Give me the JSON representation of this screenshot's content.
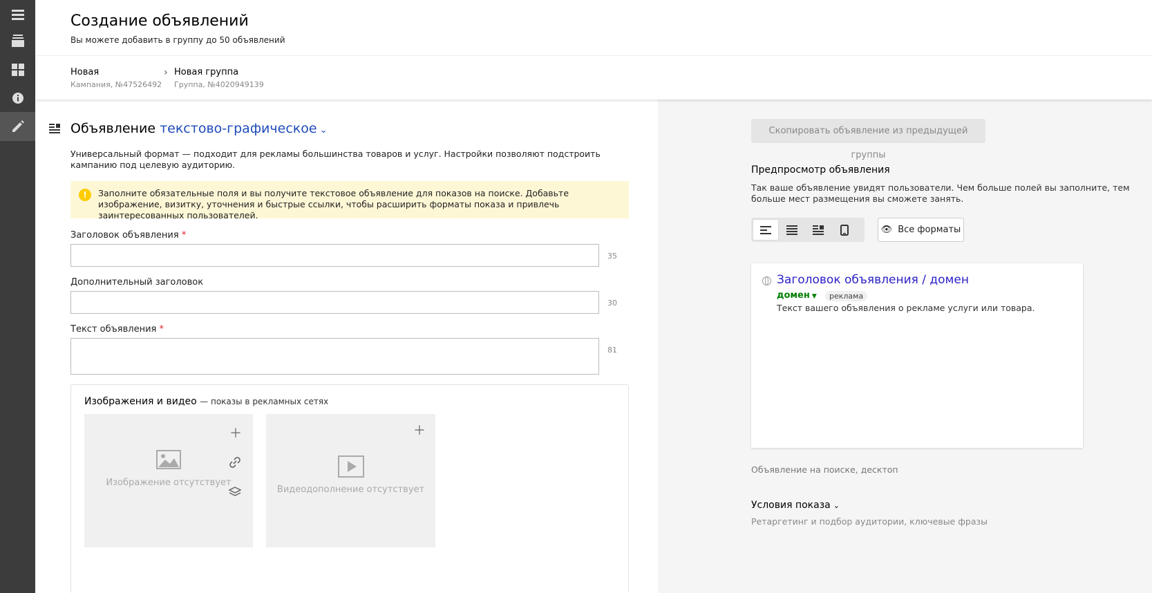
{
  "sidebar": {
    "items": [
      {
        "icon": "menu-icon"
      },
      {
        "icon": "campaigns-stack-icon"
      },
      {
        "icon": "dashboard-grid-icon"
      },
      {
        "icon": "info-icon"
      },
      {
        "icon": "pencil-icon",
        "active": true
      }
    ]
  },
  "header": {
    "title": "Создание объявлений",
    "subtitle": "Вы можете добавить в группу до 50 объявлений"
  },
  "breadcrumbs": [
    {
      "title": "Новая",
      "sub": "Кампания, №47526492"
    },
    {
      "title": "Новая группа",
      "sub": "Группа, №4020949139"
    }
  ],
  "ad": {
    "title_prefix": "Объявление",
    "type": "текстово-графическое",
    "description": "Универсальный формат — подходит для рекламы большинства товаров и услуг. Настройки позволяют подстроить кампанию под целевую аудиторию.",
    "notice": "Заполните обязательные поля и вы получите текстовое объявление для показов на поиске. Добавьте изображение, визитку, уточнения и быстрые ссылки, чтобы расширить форматы показа и привлечь заинтересованных пользователей."
  },
  "fields": {
    "headline": {
      "label": "Заголовок объявления",
      "required_mark": "*",
      "value": "",
      "counter": "35"
    },
    "extra_headline": {
      "label": "Дополнительный заголовок",
      "value": "",
      "counter": "30"
    },
    "text": {
      "label": "Текст объявления",
      "required_mark": "*",
      "value": "",
      "counter": "81"
    }
  },
  "media": {
    "title": "Изображения и видео",
    "subtitle": "— показы в рекламных сетях",
    "image_empty": "Изображение отсутствует",
    "video_empty": "Видеодополнение отсутствует"
  },
  "preview": {
    "copy_button": "Скопировать объявление из предыдущей группы",
    "title": "Предпросмотр объявления",
    "description": "Так ваше объявление увидят пользователи. Чем больше полей вы заполните, тем больше мест размещения вы сможете занять.",
    "all_formats": "Все форматы",
    "card": {
      "title": "Заголовок объявления / домен",
      "domain": "домен",
      "badge": "реклама",
      "text": "Текст вашего объявления о рекламе услуги или товара."
    },
    "caption": "Объявление на поиске, десктоп"
  },
  "conditions": {
    "title": "Условия показа",
    "subtitle": "Ретаргетинг и подбор аудитории, ключевые фразы"
  },
  "colors": {
    "sidebar": "#3c3c3c",
    "link_blue": "#1e4bb8",
    "preview_title": "#2a22c6",
    "domain_green": "#007f00",
    "notice_bg": "#fef7d6",
    "required_red": "#e0242b"
  }
}
